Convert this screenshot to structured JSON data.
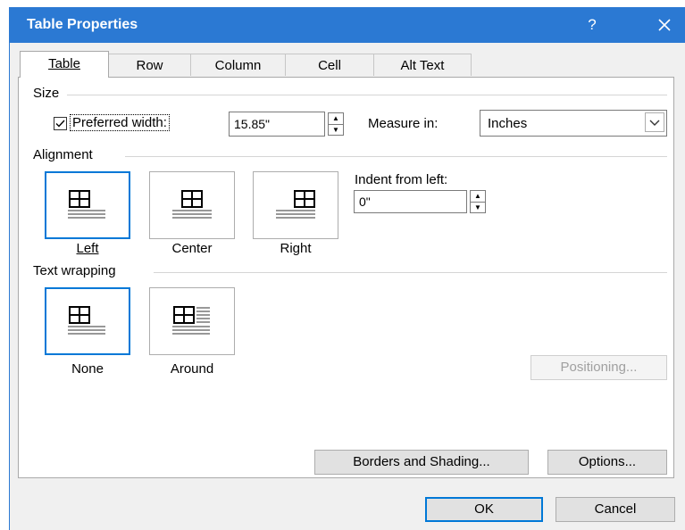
{
  "window": {
    "title": "Table Properties",
    "help": "?",
    "close_icon": "close-icon"
  },
  "tabs": [
    {
      "label": "Table",
      "active": true
    },
    {
      "label": "Row",
      "active": false
    },
    {
      "label": "Column",
      "active": false
    },
    {
      "label": "Cell",
      "active": false
    },
    {
      "label": "Alt Text",
      "active": false
    }
  ],
  "size": {
    "group_label": "Size",
    "preferred_width_checked": true,
    "preferred_width_label": "Preferred width:",
    "width_value": "15.85\"",
    "measure_in_label": "Measure in:",
    "measure_in_value": "Inches"
  },
  "alignment": {
    "group_label": "Alignment",
    "options": [
      {
        "label": "Left",
        "selected": true
      },
      {
        "label": "Center",
        "selected": false
      },
      {
        "label": "Right",
        "selected": false
      }
    ],
    "indent_label": "Indent from left:",
    "indent_value": "0\""
  },
  "text_wrapping": {
    "group_label": "Text wrapping",
    "options": [
      {
        "label": "None",
        "selected": true
      },
      {
        "label": "Around",
        "selected": false
      }
    ],
    "positioning_button": "Positioning..."
  },
  "buttons": {
    "borders_shading": "Borders and Shading...",
    "options": "Options...",
    "ok": "OK",
    "cancel": "Cancel"
  },
  "colors": {
    "titlebar": "#2b79d3",
    "selection": "#0078d7"
  }
}
